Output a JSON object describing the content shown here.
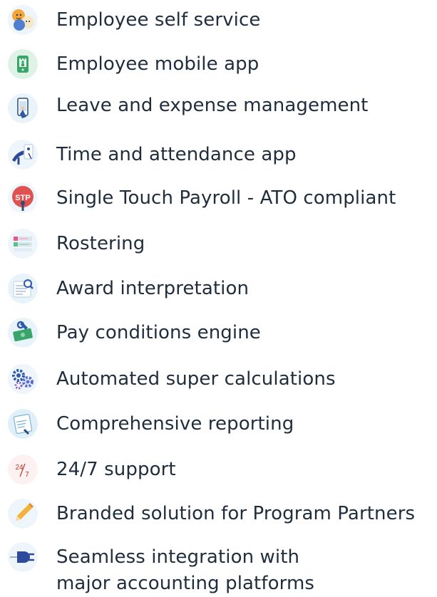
{
  "features": [
    {
      "label": "Employee self service",
      "icon": "employee-self-service-icon"
    },
    {
      "label": "Employee mobile app",
      "icon": "mobile-app-icon"
    },
    {
      "label": "Leave and expense management",
      "icon": "leave-expense-icon"
    },
    {
      "label": "Time and attendance app",
      "icon": "time-attendance-icon"
    },
    {
      "label": "Single Touch Payroll - ATO compliant",
      "icon": "stp-icon"
    },
    {
      "label": "Rostering",
      "icon": "rostering-icon"
    },
    {
      "label": "Award interpretation",
      "icon": "award-interpretation-icon"
    },
    {
      "label": "Pay conditions engine",
      "icon": "pay-conditions-icon"
    },
    {
      "label": "Automated super calculations",
      "icon": "super-calculations-icon"
    },
    {
      "label": "Comprehensive reporting",
      "icon": "reporting-icon"
    },
    {
      "label": "24/7 support",
      "icon": "support-icon"
    },
    {
      "label": "Branded solution for Program Partners",
      "icon": "pencil-icon"
    },
    {
      "label": "Seamless integration with major accounting platforms",
      "line1": "Seamless integration with",
      "line2": "major accounting platforms",
      "icon": "plug-icon"
    }
  ],
  "icon_text": {
    "stp": "STP",
    "support_24": "24",
    "support_7": "7"
  },
  "colors": {
    "text": "#1f2d3d",
    "icon_bg": "#e8f4fa",
    "accent_blue": "#2f5aa8",
    "accent_green": "#3aa56b",
    "accent_red": "#d83a3a",
    "accent_orange": "#f4a63a"
  }
}
